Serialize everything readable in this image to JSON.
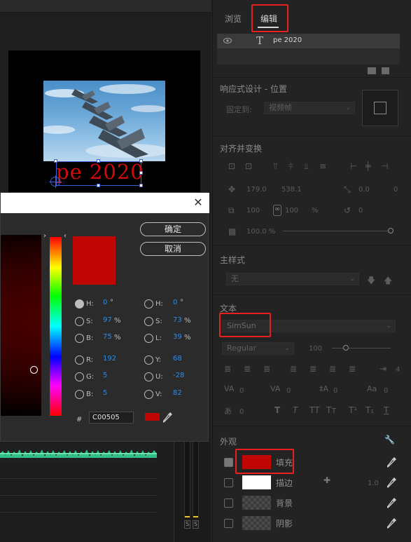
{
  "program_monitor": {
    "overlay_text": "pe 2020"
  },
  "color_picker": {
    "ok_label": "确定",
    "cancel_label": "取消",
    "close_glyph": "✕",
    "hsb": {
      "h_label": "H:",
      "h_value": "0",
      "h_unit": "°",
      "s_label": "S:",
      "s_value": "97",
      "s_unit": "%",
      "b_label": "B:",
      "b_value": "75",
      "b_unit": "%"
    },
    "hsl": {
      "h_label": "H:",
      "h_value": "0",
      "h_unit": "°",
      "s_label": "S:",
      "s_value": "73",
      "s_unit": "%",
      "l_label": "L:",
      "l_value": "39",
      "l_unit": "%"
    },
    "rgb": {
      "r_label": "R:",
      "r_value": "192",
      "g_label": "G:",
      "g_value": "5",
      "b_label": "B:",
      "b_value": "5"
    },
    "yuv": {
      "y_label": "Y:",
      "y_value": "68",
      "u_label": "U:",
      "u_value": "-28",
      "v_label": "V:",
      "v_value": "82"
    },
    "hex_prefix": "#",
    "hex_value": "C00505",
    "selected_color": "#c00505"
  },
  "panel": {
    "tabs": [
      "浏览",
      "编辑"
    ],
    "active_tab": "编辑",
    "layer_name": "pe 2020",
    "responsive": {
      "title": "响应式设计 - 位置",
      "pin_label": "固定到:",
      "pin_value": "视频帧"
    },
    "align": {
      "title": "对齐并变换",
      "pos_x": "179.0",
      "pos_y": "538.1",
      "anchor_x": "0.0",
      "anchor_y": "0",
      "scale_w": "100",
      "scale_h": "100",
      "scale_unit": "%",
      "rotation": "0",
      "opacity": "100.0 %"
    },
    "master_style": {
      "title": "主样式",
      "value": "无"
    },
    "text": {
      "title": "文本",
      "font": "SimSun",
      "style": "Regular",
      "size": "100",
      "tracking": "0",
      "kerning": "0",
      "leading": "0",
      "baseline": "0",
      "tsume": "0",
      "indent": "4"
    },
    "appearance": {
      "title": "外观",
      "fill_label": "填充",
      "fill_color": "#c00505",
      "stroke_label": "描边",
      "stroke_color": "#ffffff",
      "stroke_width": "1.0",
      "background_label": "背景",
      "shadow_label": "阴影"
    }
  }
}
